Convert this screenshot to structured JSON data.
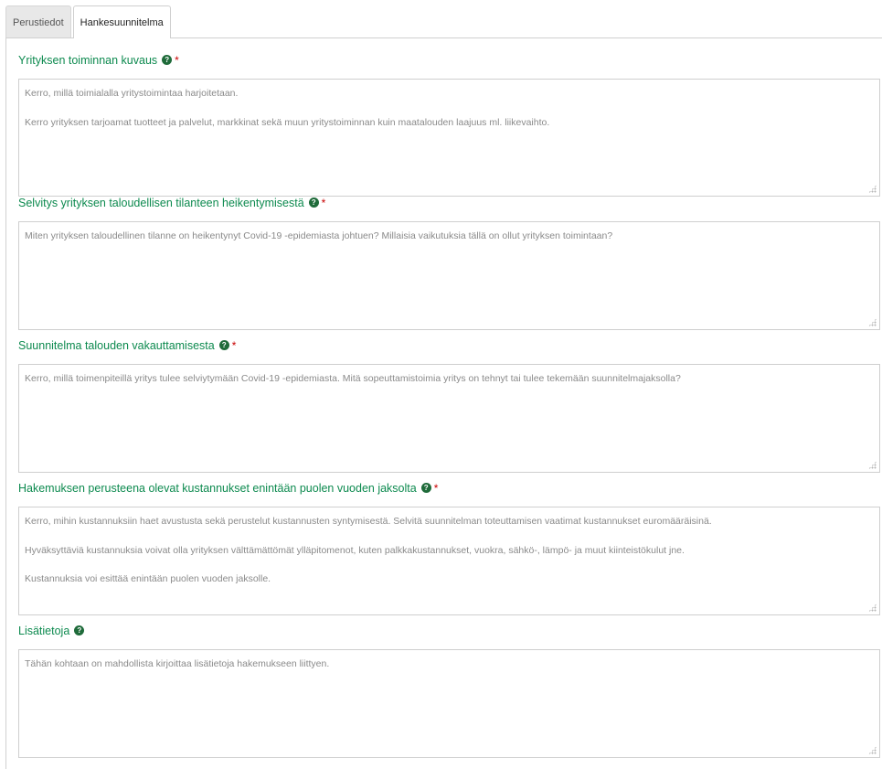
{
  "tabs": [
    {
      "label": "Perustiedot",
      "active": false
    },
    {
      "label": "Hankesuunnitelma",
      "active": true
    }
  ],
  "fields": [
    {
      "label": "Yrityksen toiminnan kuvaus",
      "required": "*",
      "help_icon": "?",
      "placeholder": [
        "Kerro, millä toimialalla yritystoimintaa harjoitetaan.",
        "Kerro yrityksen tarjoamat tuotteet ja palvelut, markkinat sekä muun yritystoiminnan kuin maatalouden laajuus ml. liikevaihto."
      ]
    },
    {
      "label": "Selvitys yrityksen taloudellisen tilanteen heikentymisestä",
      "required": "*",
      "help_icon": "?",
      "placeholder": [
        "Miten yrityksen taloudellinen tilanne on heikentynyt Covid-19 -epidemiasta johtuen? Millaisia vaikutuksia tällä on ollut yrityksen toimintaan?"
      ]
    },
    {
      "label": "Suunnitelma talouden vakauttamisesta",
      "required": "*",
      "help_icon": "?",
      "placeholder": [
        "Kerro, millä toimenpiteillä yritys tulee selviytymään Covid-19 -epidemiasta. Mitä sopeuttamistoimia yritys on tehnyt tai tulee tekemään suunnitelmajaksolla?"
      ]
    },
    {
      "label": "Hakemuksen perusteena olevat kustannukset enintään puolen vuoden jaksolta",
      "required": "*",
      "help_icon": "?",
      "placeholder": [
        "Kerro, mihin kustannuksiin haet avustusta sekä perustelut kustannusten syntymisestä. Selvitä suunnitelman toteuttamisen vaatimat kustannukset euromääräisinä.",
        "Hyväksyttäviä kustannuksia voivat olla yrityksen välttämättömät ylläpitomenot, kuten palkkakustannukset, vuokra, sähkö-, lämpö- ja muut kiinteistökulut jne.",
        "Kustannuksia voi esittää enintään puolen vuoden jaksolle."
      ]
    },
    {
      "label": "Lisätietoja",
      "required": "",
      "help_icon": "?",
      "placeholder": [
        "Tähän kohtaan on mahdollista kirjoittaa lisätietoja hakemukseen liittyen."
      ]
    }
  ],
  "colors": {
    "label": "#0d8a4f",
    "required": "#c80000",
    "help_icon_bg": "#1f6b3a"
  }
}
